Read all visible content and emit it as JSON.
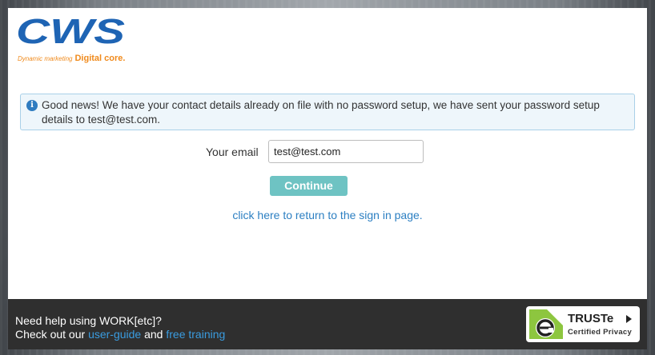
{
  "logo": {
    "wordmark": "CWS",
    "tagline_left": "Dynamic marketing",
    "tagline_right": "Digital core."
  },
  "notice": {
    "icon": "info-icon",
    "text": "Good news! We have your contact details already on file with no password setup, we have sent your password setup details to test@test.com."
  },
  "form": {
    "email_label": "Your email",
    "email_value": "test@test.com",
    "continue_label": "Continue",
    "return_link": "click here to return to the sign in page."
  },
  "footer": {
    "line1": "Need help using WORK[etc]?",
    "line2_prefix": "Check out our ",
    "user_guide": "user-guide",
    "and": " and ",
    "free_training": "free training"
  },
  "truste": {
    "name": "TRUSTe",
    "sub": "Certified Privacy"
  },
  "colors": {
    "accent_blue": "#2c7fc2",
    "logo_blue": "#1e64b4",
    "logo_orange": "#f08a1c",
    "button_teal": "#6ec3c3",
    "footer_bg": "#2f2f2f",
    "truste_green": "#8dc63f"
  }
}
